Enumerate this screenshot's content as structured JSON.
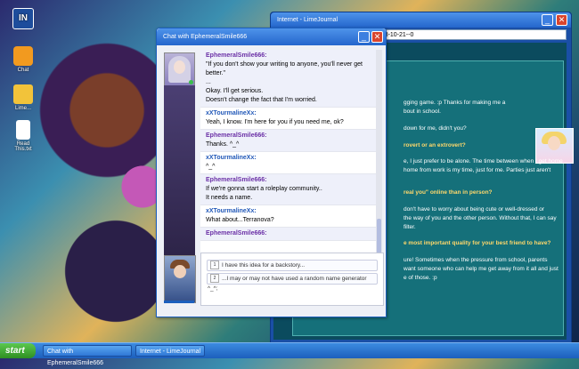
{
  "desktop": {
    "logo_text": "IN",
    "icons": [
      {
        "label": "Chat"
      },
      {
        "label": "Lime..."
      },
      {
        "label": "Read This.txt"
      }
    ]
  },
  "browser": {
    "title": "Internet - LimeJournal",
    "address": "2003-10-21--0",
    "lines": [
      {
        "text": "gging game. :p Thanks for making me a",
        "q": false
      },
      {
        "text": "bout in school.",
        "q": false
      },
      {
        "text": "down for me, didn't you?",
        "q": false
      },
      {
        "text": "rovert or an extrovert?",
        "q": true
      },
      {
        "text": "e, I just prefer to be alone. The time between when I get home",
        "q": false
      },
      {
        "text": "home from work is my time, just for me. Parties just aren't",
        "q": false
      },
      {
        "text": "real you\" online than in person?",
        "q": true
      },
      {
        "text": "don't have to worry about being cute or well-dressed or",
        "q": false
      },
      {
        "text": "the way of you and the other person. Without that, I can say",
        "q": false
      },
      {
        "text": "filter.",
        "q": false
      },
      {
        "text": "e most important quality for your best friend to have?",
        "q": true
      },
      {
        "text": "ure! Sometimes when the pressure from school, parents",
        "q": false
      },
      {
        "text": "want someone who can help me get away from it all and just",
        "q": false
      },
      {
        "text": "e of those. :p",
        "q": false
      }
    ]
  },
  "chat": {
    "title": "Chat with EphemeralSmile666",
    "messages": [
      {
        "from": "EphemeralSmile666:",
        "side": "a",
        "lines": [
          "\"If you don't show your writing to anyone, you'll never get",
          "better.\"",
          "...",
          "Okay. I'll get serious.",
          "Doesn't change the fact that I'm worried."
        ]
      },
      {
        "from": "xXTourmalineXx:",
        "side": "b",
        "lines": [
          "Yeah, I know. I'm here for you if you need me, ok?"
        ]
      },
      {
        "from": "EphemeralSmile666:",
        "side": "a",
        "lines": [
          "Thanks. ^_^"
        ]
      },
      {
        "from": "xXTourmalineXx:",
        "side": "b",
        "lines": [
          "^_^"
        ]
      },
      {
        "from": "EphemeralSmile666:",
        "side": "a",
        "lines": [
          "If we're gonna start a roleplay community..",
          "It needs a name."
        ]
      },
      {
        "from": "xXTourmalineXx:",
        "side": "b",
        "lines": [
          "What about...Terranova?"
        ]
      },
      {
        "from": "EphemeralSmile666:",
        "side": "a",
        "lines": [
          ""
        ]
      }
    ],
    "options": [
      {
        "num": "1",
        "text": "I have this idea for a backstory..."
      },
      {
        "num": "2",
        "text": "...I may or may not have used a random name generator ^_^;"
      }
    ]
  },
  "taskbar": {
    "start": "start",
    "tasks": [
      "Chat with EphemeralSmile666",
      "Internet - LimeJournal"
    ]
  }
}
